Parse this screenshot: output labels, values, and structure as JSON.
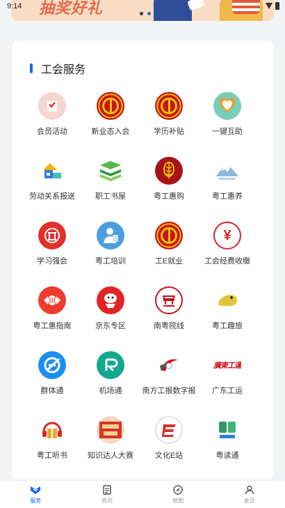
{
  "status": {
    "time": "9:14"
  },
  "banner": {
    "text": "抽奖好礼",
    "slides": 4,
    "active_slide": 1
  },
  "section": {
    "title": "工会服务"
  },
  "services": [
    {
      "label": "会员活动",
      "icon": "member-activity-icon"
    },
    {
      "label": "新业态入会",
      "icon": "union-emblem-icon"
    },
    {
      "label": "学历补贴",
      "icon": "union-emblem-icon"
    },
    {
      "label": "一键互助",
      "icon": "mutual-aid-icon"
    },
    {
      "label": "劳动关系报送",
      "icon": "labor-relations-icon"
    },
    {
      "label": "职工书屋",
      "icon": "books-icon"
    },
    {
      "label": "粤工惠购",
      "icon": "wheat-emblem-icon"
    },
    {
      "label": "粤工惠养",
      "icon": "mountain-icon"
    },
    {
      "label": "学习强会",
      "icon": "study-icon"
    },
    {
      "label": "粤工培训",
      "icon": "training-icon"
    },
    {
      "label": "工E就业",
      "icon": "union-emblem-icon"
    },
    {
      "label": "工会经费收缴",
      "icon": "yuan-icon"
    },
    {
      "label": "粤工惠指南",
      "icon": "guide-icon"
    },
    {
      "label": "京东专区",
      "icon": "jd-dog-icon"
    },
    {
      "label": "南粤院线",
      "icon": "cinema-icon"
    },
    {
      "label": "粤工趣旅",
      "icon": "travel-icon"
    },
    {
      "label": "群体通",
      "icon": "group-icon"
    },
    {
      "label": "机场通",
      "icon": "airport-icon"
    },
    {
      "label": "南方工报数字报",
      "icon": "newspaper-icon"
    },
    {
      "label": "广东工运",
      "icon": "calligraphy-icon"
    },
    {
      "label": "粤工听书",
      "icon": "audiobook-icon"
    },
    {
      "label": "知识达人大赛",
      "icon": "quiz-contest-icon"
    },
    {
      "label": "文化E站",
      "icon": "culture-icon"
    },
    {
      "label": "粤读通",
      "icon": "reading-icon"
    }
  ],
  "tabs": [
    {
      "label": "服务",
      "icon": "service-icon",
      "active": true
    },
    {
      "label": "资讯",
      "icon": "news-icon",
      "active": false
    },
    {
      "label": "地图",
      "icon": "compass-icon",
      "active": false
    },
    {
      "label": "会员",
      "icon": "user-icon",
      "active": false
    }
  ],
  "colors": {
    "accent": "#1769e8",
    "union_red": "#c8141c",
    "union_gold": "#f2c200"
  }
}
